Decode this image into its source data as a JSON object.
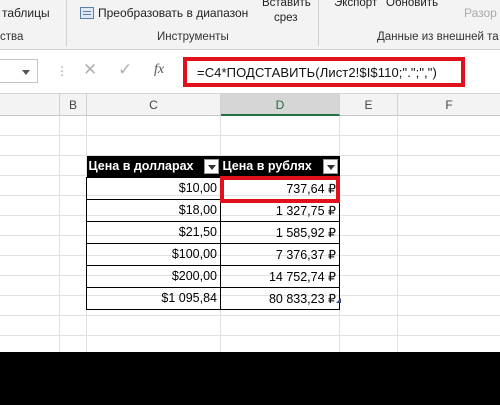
{
  "ribbon": {
    "top_left": "таблицы",
    "convert_range": "Преобразовать в диапазон",
    "insert_slicer_line1": "Вставить",
    "insert_slicer_line2": "срез",
    "export": "Экспорт",
    "refresh": "Обновить",
    "right_partial": "Разор",
    "groups": {
      "left_partial": "ства",
      "tools": "Инструменты",
      "external_data": "Данные из внешней та"
    }
  },
  "formula_bar": {
    "dots": "⋮",
    "cancel": "✕",
    "enter": "✓",
    "fx": "fx",
    "formula": "=C4*ПОДСТАВИТЬ(Лист2!$I$110;\".\";\",\")"
  },
  "columns": [
    "B",
    "C",
    "D",
    "E",
    "F"
  ],
  "active_column": "D",
  "table": {
    "headers": [
      "Цена в долларах",
      "Цена в рублях"
    ],
    "rows": [
      [
        "$10,00",
        "737,64 ₽"
      ],
      [
        "$18,00",
        "1 327,75 ₽"
      ],
      [
        "$21,50",
        "1 585,92 ₽"
      ],
      [
        "$100,00",
        "7 376,37 ₽"
      ],
      [
        "$200,00",
        "14 752,74 ₽"
      ],
      [
        "$1 095,84",
        "80 833,23 ₽"
      ]
    ]
  },
  "colors": {
    "highlight": "#e0101c",
    "excel_green": "#217346",
    "header_bg": "#000000"
  }
}
